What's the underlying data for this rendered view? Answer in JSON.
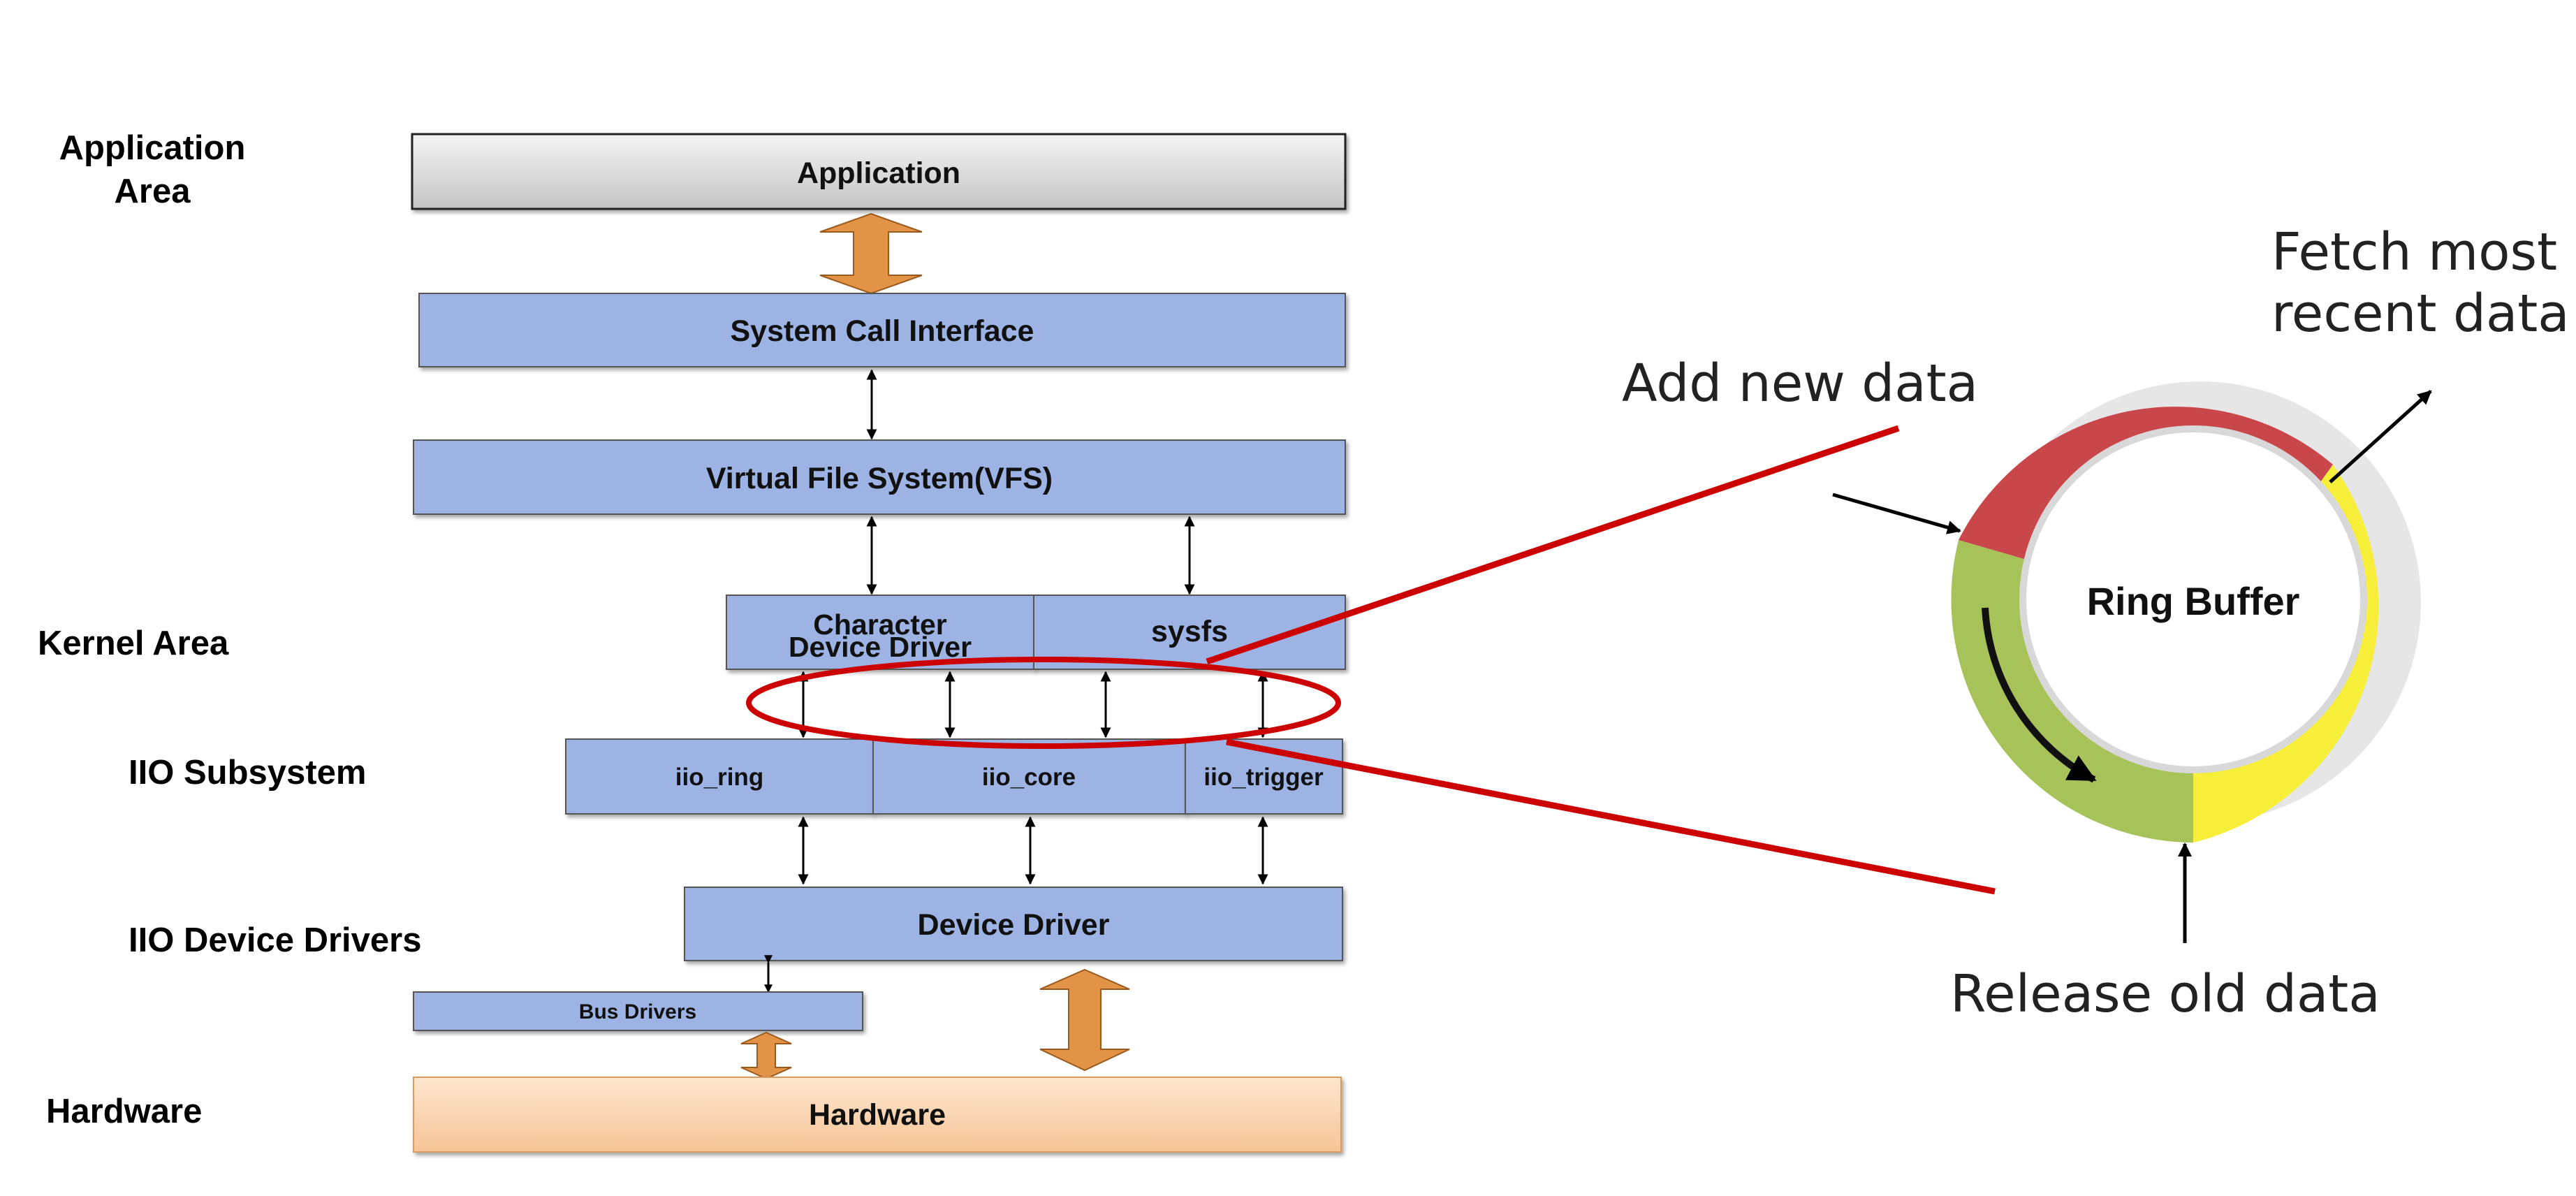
{
  "area_labels": {
    "application_line1": "Application",
    "application_line2": "Area",
    "kernel": "Kernel Area",
    "iio_subsystem": "IIO Subsystem",
    "iio_device_drivers": "IIO Device Drivers",
    "hardware": "Hardware"
  },
  "boxes": {
    "application": "Application",
    "system_call_interface": "System Call Interface",
    "vfs": "Virtual File System(VFS)",
    "char_driver_line1": "Character",
    "char_driver_line2": "Device Driver",
    "sysfs": "sysfs",
    "iio_ring": "iio_ring",
    "iio_core": "iio_core",
    "iio_trigger": "iio_trigger",
    "device_driver": "Device Driver",
    "bus_drivers": "Bus Drivers",
    "hardware": "Hardware"
  },
  "ring": {
    "label": "Ring Buffer",
    "add_new": "Add new data",
    "fetch_line1": "Fetch most",
    "fetch_line2": "recent data",
    "release": "Release old data"
  },
  "colors": {
    "kernel_box": "#9cb3e3",
    "application_box": "#d6d6d6",
    "hardware_box": "#fad2ad",
    "big_arrow": "#e29346",
    "highlight": "#cc0000",
    "ring_red": "#c9474a",
    "ring_green": "#a8c25a",
    "ring_yellow": "#f7ee3a"
  }
}
